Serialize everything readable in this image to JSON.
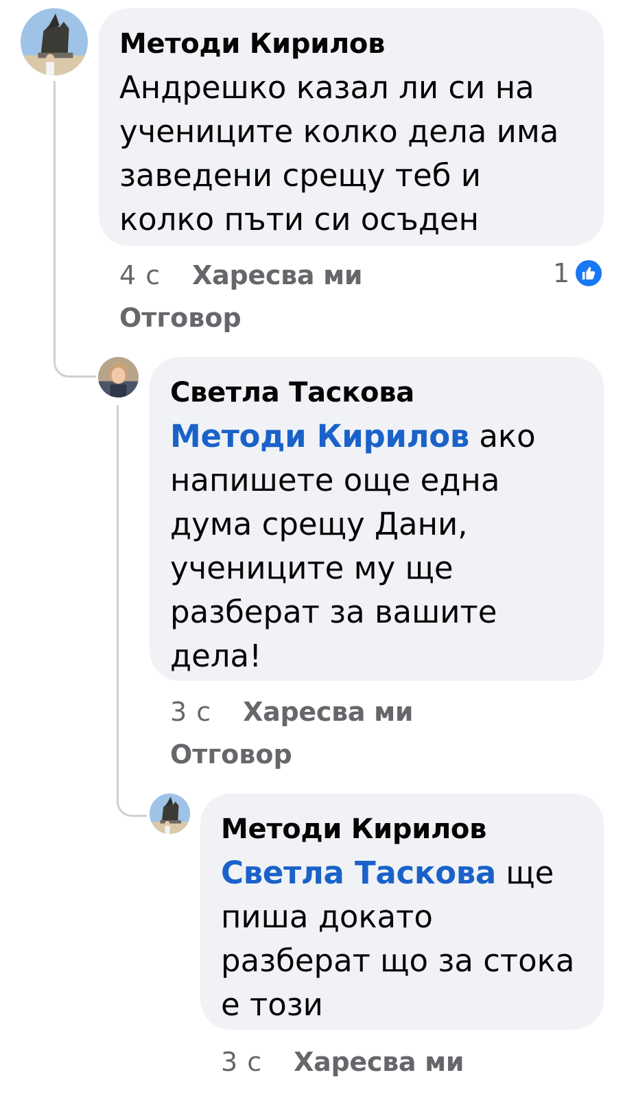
{
  "comments": [
    {
      "author": "Методи Кирилов",
      "mention": "",
      "text": "Андрешко казал ли си на\nучениците колко дела има\nзаведени срещу теб и\nколко пъти си осъден",
      "time": "4 с",
      "like_label": "Харесва ми",
      "reply_label": "Отговор",
      "reaction_count": "1"
    },
    {
      "author": "Светла Таскова",
      "mention": "Методи Кирилов",
      "text": " ако\nнапишете още една\nдума срещу Дани,\nучениците му ще\nразберат за вашите\nдела!",
      "time": "3 с",
      "like_label": "Харесва ми",
      "reply_label": "Отговор"
    },
    {
      "author": "Методи Кирилов",
      "mention": "Светла Таскова",
      "text": " ще\nпиша докато\nразберат що за стока\nе този",
      "time": "3 с",
      "like_label": "Харесва ми"
    }
  ],
  "colors": {
    "bubble": "#f0f2f5",
    "mention": "#1a62c9",
    "meta": "#65676b",
    "like_icon": "#1877f2"
  },
  "icons": {
    "reaction": "like-thumb-icon"
  }
}
